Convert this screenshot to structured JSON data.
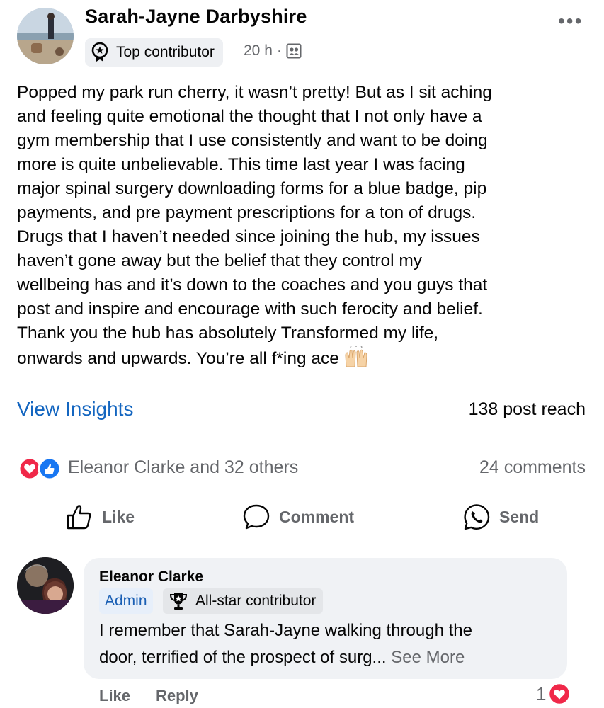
{
  "post": {
    "author": "Sarah-Jayne Darbyshire",
    "badge": "Top contributor",
    "time": "20 h",
    "separator": "·",
    "body_lines": [
      "Popped my park run cherry, it wasn’t pretty! But as I sit aching",
      "and feeling quite emotional the thought that I not only have a",
      "gym membership that I use consistently and want to be doing",
      "more is quite unbelievable. This time last year I was facing",
      "major spinal surgery downloading forms for a blue badge, pip",
      "payments, and pre payment prescriptions for a ton of drugs.",
      "Drugs that I haven’t needed since joining the hub, my issues",
      "haven’t gone away but the belief that they control my",
      "wellbeing has and it’s down to the coaches and you guys that",
      "post and inspire and encourage with such ferocity and belief.",
      "Thank you the hub has absolutely Transformed my life,",
      "onwards and upwards.  You’re all f*ing ace"
    ],
    "view_insights": "View Insights",
    "post_reach": "138 post reach",
    "reactors": "Eleanor Clarke and 32 others",
    "comments_count": "24 comments"
  },
  "actions": {
    "like": "Like",
    "comment": "Comment",
    "send": "Send"
  },
  "comment": {
    "author": "Eleanor Clarke",
    "role_badge": "Admin",
    "contributor_badge": "All-star contributor",
    "text_line1": "I remember that Sarah-Jayne walking through the",
    "text_line2": "door, terrified of the prospect of surg...",
    "see_more": "See More",
    "like": "Like",
    "reply": "Reply",
    "reaction_count": "1"
  },
  "colors": {
    "link_blue": "#1466c0",
    "heart_red": "#f02849",
    "like_blue": "#1877f2",
    "muted_text": "#65676b"
  }
}
